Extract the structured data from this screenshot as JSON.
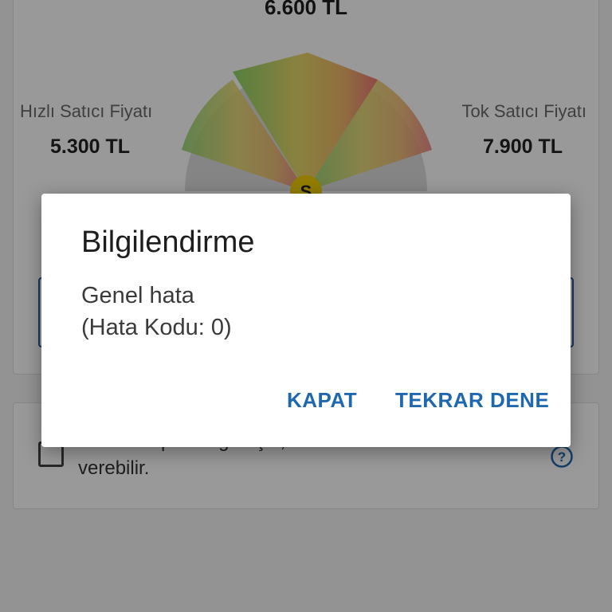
{
  "price_panel": {
    "center_price": "6.600 TL",
    "left_label": "Hızlı Satıcı Fiyatı",
    "left_price": "5.300 TL",
    "right_label": "Tok Satıcı Fiyatı",
    "right_price": "7.900 TL",
    "gauge_marker": "S"
  },
  "consent": {
    "line1": "Ürünlerin pazarlığa açık, alıcılar teklif",
    "line2": "verebilir.",
    "checked": false,
    "help_icon": "question-circle-icon"
  },
  "dialog": {
    "title": "Bilgilendirme",
    "message_line1": "Genel hata",
    "message_line2": "(Hata Kodu: 0)",
    "close_label": "KAPAT",
    "retry_label": "TEKRAR DENE"
  },
  "colors": {
    "accent": "#1f68b0",
    "marker": "#f5d000"
  }
}
